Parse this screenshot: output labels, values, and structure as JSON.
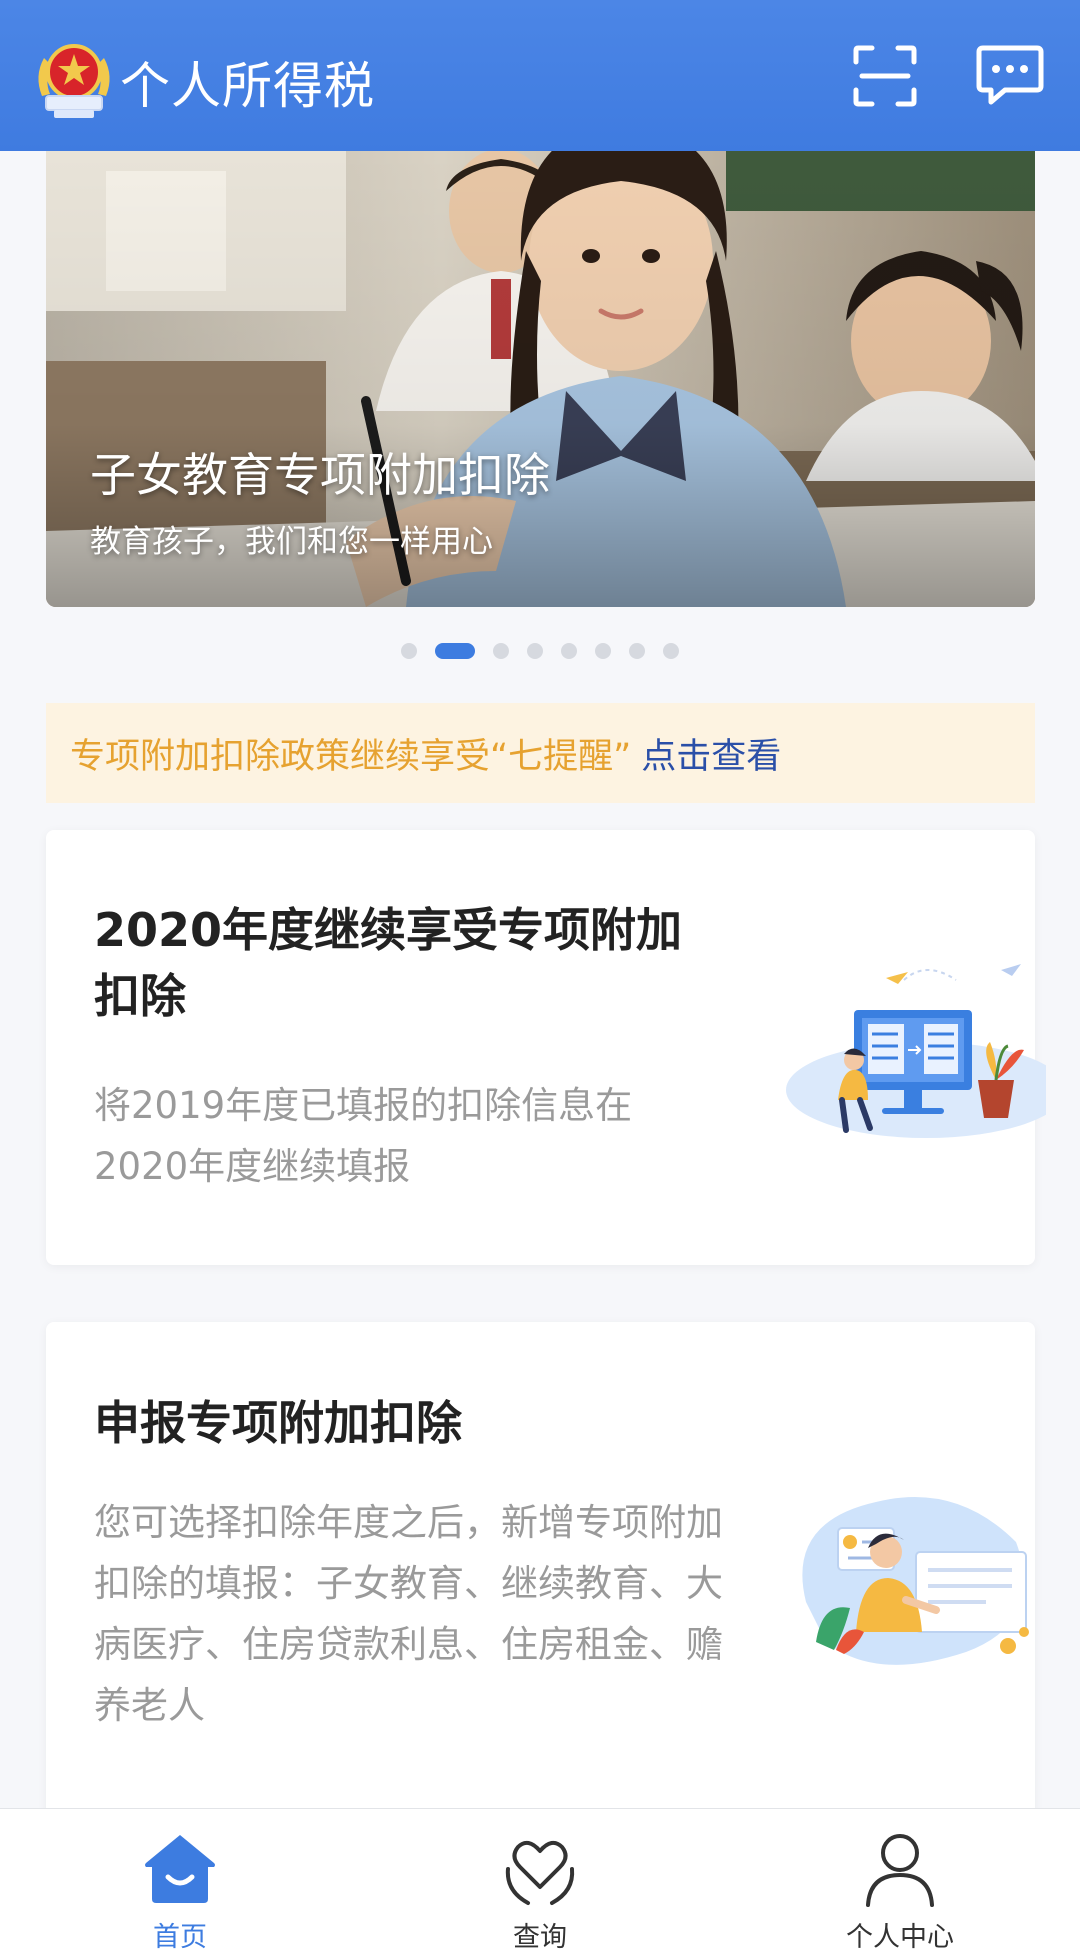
{
  "header": {
    "title": "个人所得税",
    "logo_icon": "tax-emblem-icon",
    "scan_icon": "scan-icon",
    "message_icon": "message-icon",
    "bg_color": "#4a84e4"
  },
  "banner": {
    "title": "子女教育专项附加扣除",
    "subtitle": "教育孩子，我们和您一样用心",
    "pager": {
      "count": 8,
      "active_index": 1
    }
  },
  "notice": {
    "text": "专项附加扣除政策继续享受“七提醒”",
    "link": "点击查看",
    "text_color": "#e6a230",
    "link_color": "#2a4fa8"
  },
  "cards": [
    {
      "title": "2020年度继续享受专项附加扣除",
      "description": "将2019年度已填报的扣除信息在2020年度继续填报",
      "icon": "computer-worker-illustration"
    },
    {
      "title": "申报专项附加扣除",
      "description": "您可选择扣除年度之后，新增专项附加扣除的填报：子女教育、继续教育、大病医疗、住房贷款利息、住房租金、赡养老人",
      "icon": "person-form-illustration"
    }
  ],
  "bottom_nav": {
    "items": [
      {
        "label": "首页",
        "icon": "home-icon",
        "active": true
      },
      {
        "label": "查询",
        "icon": "heart-hands-icon",
        "active": false
      },
      {
        "label": "个人中心",
        "icon": "person-icon",
        "active": false
      }
    ],
    "active_color": "#3d7ce0"
  }
}
